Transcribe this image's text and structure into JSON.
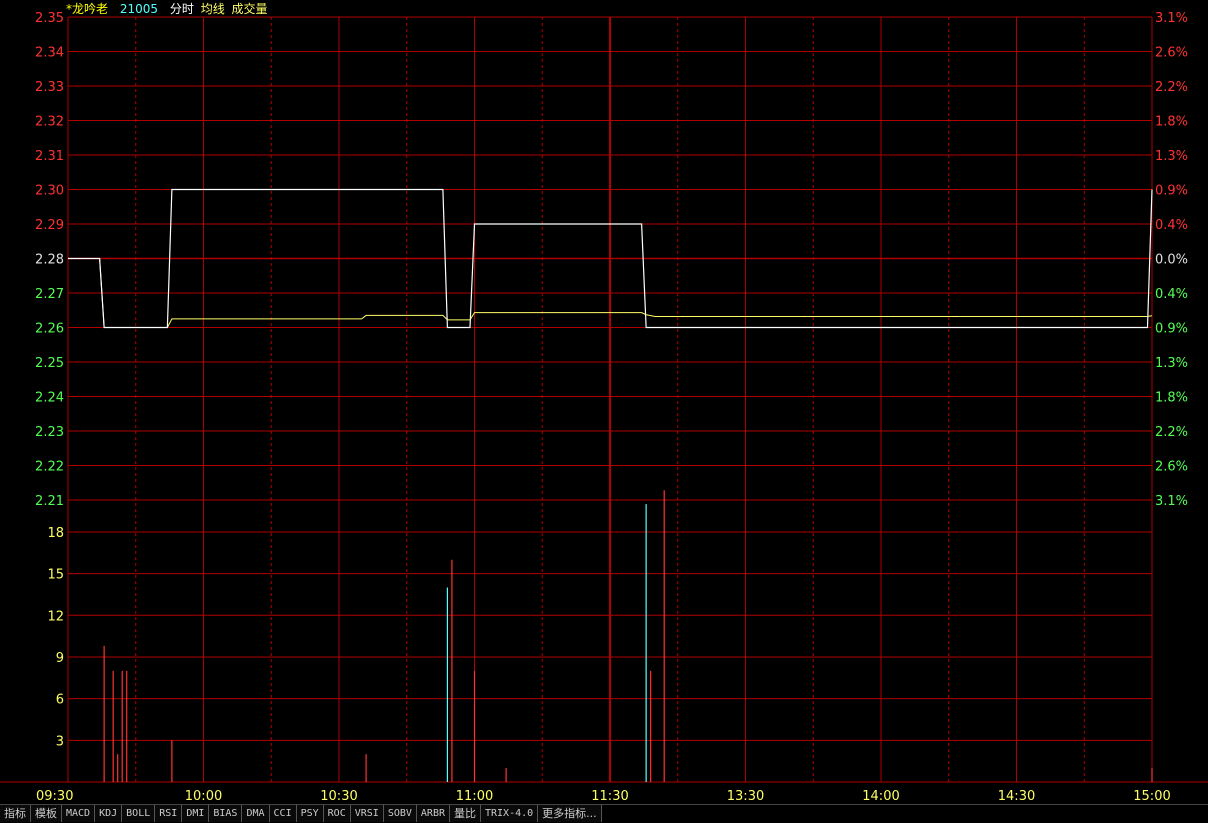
{
  "header": {
    "stock_name": "*龙吟老",
    "code": "21005",
    "label_fenshi": "分时",
    "label_junxian": "均线",
    "label_volume": "成交量"
  },
  "colors": {
    "up": "#ff3232",
    "down": "#54ff54",
    "neutral": "#e0e0e0",
    "grid": "#b00000",
    "avg": "#ffff66",
    "price": "#ffffff",
    "vol_down": "#54ffff",
    "header_name": "#ffff00",
    "header_code": "#54ffff",
    "xaxis": "#ffff66"
  },
  "chart_data": {
    "type": "line",
    "price_axis": {
      "ticks": [
        "2.35",
        "2.34",
        "2.33",
        "2.32",
        "2.31",
        "2.30",
        "2.29",
        "2.28",
        "2.27",
        "2.26",
        "2.25",
        "2.24",
        "2.23",
        "2.22",
        "2.21"
      ],
      "ylim": [
        2.21,
        2.35
      ],
      "prev_close": 2.28
    },
    "pct_axis": {
      "ticks": [
        "3.1%",
        "2.6%",
        "2.2%",
        "1.8%",
        "1.3%",
        "0.9%",
        "0.4%",
        "0.0%",
        "0.4%",
        "0.9%",
        "1.3%",
        "1.8%",
        "2.2%",
        "2.6%",
        "3.1%"
      ]
    },
    "time_axis": {
      "labels": [
        "09:30",
        "10:00",
        "10:30",
        "11:00",
        "11:30",
        "13:30",
        "14:00",
        "14:30",
        "15:00"
      ],
      "total_minutes": 240
    },
    "price_series": [
      [
        0,
        2.28
      ],
      [
        7,
        2.28
      ],
      [
        8,
        2.26
      ],
      [
        22,
        2.26
      ],
      [
        23,
        2.3
      ],
      [
        83,
        2.3
      ],
      [
        84,
        2.26
      ],
      [
        89,
        2.26
      ],
      [
        90,
        2.29
      ],
      [
        127,
        2.29
      ],
      [
        128,
        2.26
      ],
      [
        239,
        2.26
      ],
      [
        240,
        2.3
      ]
    ],
    "avg_series": [
      [
        0,
        2.28
      ],
      [
        7,
        2.28
      ],
      [
        8,
        2.26
      ],
      [
        22,
        2.26
      ],
      [
        23,
        2.2625
      ],
      [
        65,
        2.2625
      ],
      [
        66,
        2.2635
      ],
      [
        83,
        2.2635
      ],
      [
        84,
        2.2622
      ],
      [
        89,
        2.2622
      ],
      [
        90,
        2.2643
      ],
      [
        127,
        2.2643
      ],
      [
        128,
        2.2637
      ],
      [
        130,
        2.2632
      ],
      [
        239,
        2.2632
      ],
      [
        240,
        2.2634
      ]
    ],
    "volume_axis": {
      "ticks": [
        "18",
        "15",
        "12",
        "9",
        "6",
        "3"
      ],
      "ylim": [
        0,
        20.3
      ]
    },
    "volume_bars": [
      [
        8,
        9.8,
        "up"
      ],
      [
        10,
        8,
        "up"
      ],
      [
        11,
        2,
        "up"
      ],
      [
        12,
        8,
        "up"
      ],
      [
        13,
        8,
        "up"
      ],
      [
        23,
        3,
        "up"
      ],
      [
        66,
        2,
        "up"
      ],
      [
        84,
        14,
        "down"
      ],
      [
        85,
        16,
        "up"
      ],
      [
        90,
        8,
        "up"
      ],
      [
        97,
        1,
        "up"
      ],
      [
        128,
        20,
        "down"
      ],
      [
        129,
        8,
        "up"
      ],
      [
        132,
        21,
        "up"
      ],
      [
        240,
        1,
        "up"
      ]
    ]
  },
  "tabs": [
    "指标",
    "模板",
    "MACD",
    "KDJ",
    "BOLL",
    "RSI",
    "DMI",
    "BIAS",
    "DMA",
    "CCI",
    "PSY",
    "ROC",
    "VRSI",
    "SOBV",
    "ARBR",
    "量比",
    "TRIX-4.0",
    "更多指标..."
  ]
}
